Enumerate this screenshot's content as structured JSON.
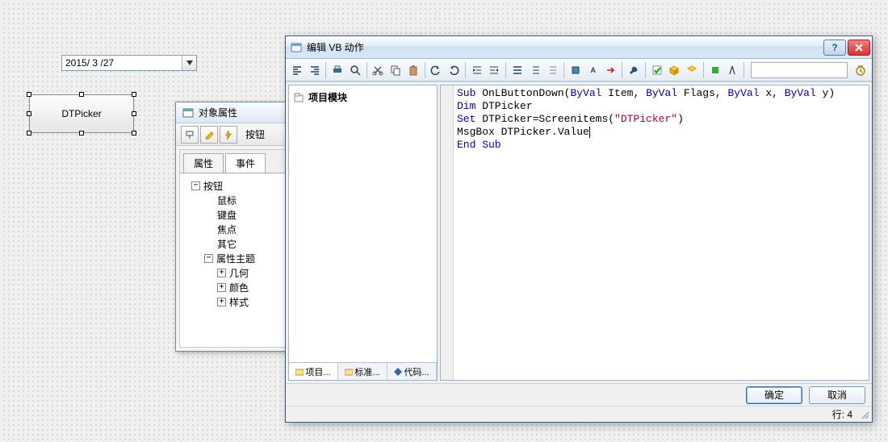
{
  "datepicker": {
    "value": "2015/ 3 /27"
  },
  "button_control": {
    "label": "DTPicker"
  },
  "props": {
    "title": "对象属性",
    "toolbar_label": "按钮",
    "tabs": {
      "properties": "属性",
      "events": "事件"
    },
    "tree": {
      "root": "按钮",
      "mouse": "鼠标",
      "keyboard": "键盘",
      "focus": "焦点",
      "other": "其它",
      "prop_theme": "属性主题",
      "geometry": "几何",
      "color": "颜色",
      "style": "样式"
    }
  },
  "vb": {
    "title": "编辑 VB 动作",
    "project_module": "项目模块",
    "left_tabs": {
      "project": "项目...",
      "standard": "标准...",
      "code": "代码..."
    },
    "footer": {
      "ok": "确定",
      "cancel": "取消"
    },
    "status": "行: 4",
    "code": {
      "line1": {
        "kw1": "Sub",
        "fn": " OnLButtonDown(",
        "kw2": "ByVal",
        "p1": " Item, ",
        "kw3": "ByVal",
        "p2": " Flags, ",
        "kw4": "ByVal",
        "p3": " x, ",
        "kw5": "ByVal",
        "p4": " y)"
      },
      "line2": {
        "kw": "Dim",
        "rest": " DTPicker"
      },
      "line3": {
        "kw": "Set",
        "rest": " DTPicker=Screenitems(",
        "str": "\"DTPicker\"",
        "close": ")"
      },
      "line4": "MsgBox DTPicker.Value",
      "line5": "End Sub"
    }
  }
}
